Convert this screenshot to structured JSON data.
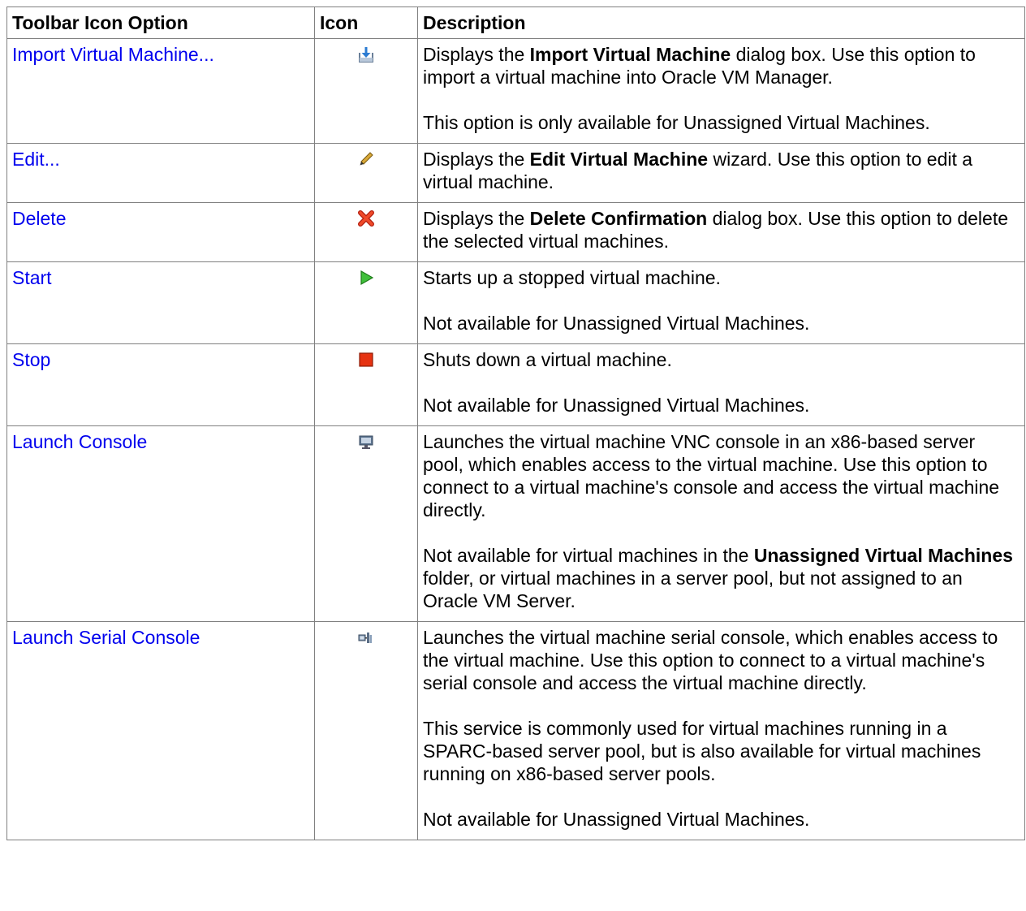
{
  "headers": {
    "option": "Toolbar Icon Option",
    "icon": "Icon",
    "description": "Description"
  },
  "rows": [
    {
      "option": "Import Virtual Machine...",
      "icon": "import-icon",
      "paragraphs": [
        [
          "Displays the ",
          {
            "b": "Import Virtual Machine"
          },
          " dialog box. Use this option to import a virtual machine into Oracle VM Manager."
        ],
        [
          "This option is only available for Unassigned Virtual Machines."
        ]
      ]
    },
    {
      "option": "Edit...",
      "icon": "pencil-icon",
      "paragraphs": [
        [
          "Displays the ",
          {
            "b": "Edit Virtual Machine"
          },
          " wizard. Use this option to edit a virtual machine."
        ]
      ]
    },
    {
      "option": "Delete",
      "icon": "delete-x-icon",
      "paragraphs": [
        [
          "Displays the ",
          {
            "b": "Delete Confirmation"
          },
          " dialog box. Use this option to delete the selected virtual machines."
        ]
      ]
    },
    {
      "option": "Start",
      "icon": "play-icon",
      "paragraphs": [
        [
          "Starts up a stopped virtual machine."
        ],
        [
          "Not available for Unassigned Virtual Machines."
        ]
      ]
    },
    {
      "option": "Stop",
      "icon": "stop-icon",
      "paragraphs": [
        [
          "Shuts down a virtual machine."
        ],
        [
          "Not available for Unassigned Virtual Machines."
        ]
      ]
    },
    {
      "option": "Launch Console",
      "icon": "monitor-icon",
      "paragraphs": [
        [
          "Launches the virtual machine VNC console in an x86-based server pool, which enables access to the virtual machine. Use this option to connect to a virtual machine's console and access the virtual machine directly."
        ],
        [
          "Not available for virtual machines in the ",
          {
            "b": "Unassigned Virtual Machines"
          },
          " folder, or virtual machines in a server pool, but not assigned to an Oracle VM Server."
        ]
      ]
    },
    {
      "option": "Launch Serial Console",
      "icon": "serial-console-icon",
      "paragraphs": [
        [
          "Launches the virtual machine serial console, which enables access to the virtual machine. Use this option to connect to a virtual machine's serial console and access the virtual machine directly."
        ],
        [
          "This service is commonly used for virtual machines running in a SPARC-based server pool, but is also available for virtual machines running on x86-based server pools."
        ],
        [
          "Not available for Unassigned Virtual Machines."
        ]
      ]
    }
  ]
}
